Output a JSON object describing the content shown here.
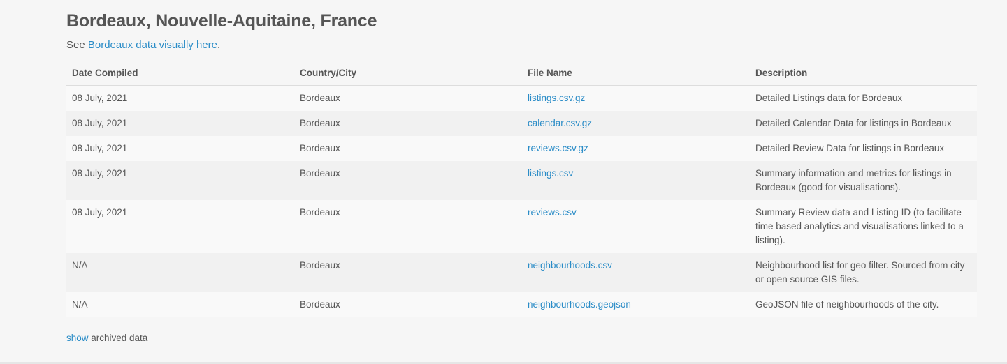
{
  "city": {
    "title": "Bordeaux, Nouvelle-Aquitaine, France",
    "see_prefix": "See ",
    "see_link": "Bordeaux data visually here",
    "see_suffix": "."
  },
  "table": {
    "headers": {
      "date": "Date Compiled",
      "city": "Country/City",
      "file": "File Name",
      "description": "Description"
    },
    "rows": [
      {
        "date": "08 July, 2021",
        "city": "Bordeaux",
        "file": "listings.csv.gz",
        "description": "Detailed Listings data for Bordeaux"
      },
      {
        "date": "08 July, 2021",
        "city": "Bordeaux",
        "file": "calendar.csv.gz",
        "description": "Detailed Calendar Data for listings in Bordeaux"
      },
      {
        "date": "08 July, 2021",
        "city": "Bordeaux",
        "file": "reviews.csv.gz",
        "description": "Detailed Review Data for listings in Bordeaux"
      },
      {
        "date": "08 July, 2021",
        "city": "Bordeaux",
        "file": "listings.csv",
        "description": "Summary information and metrics for listings in Bordeaux (good for visualisations)."
      },
      {
        "date": "08 July, 2021",
        "city": "Bordeaux",
        "file": "reviews.csv",
        "description": "Summary Review data and Listing ID (to facilitate time based analytics and visualisations linked to a listing)."
      },
      {
        "date": "N/A",
        "city": "Bordeaux",
        "file": "neighbourhoods.csv",
        "description": "Neighbourhood list for geo filter. Sourced from city or open source GIS files."
      },
      {
        "date": "N/A",
        "city": "Bordeaux",
        "file": "neighbourhoods.geojson",
        "description": "GeoJSON file of neighbourhoods of the city."
      }
    ]
  },
  "archived": {
    "link": "show",
    "text": " archived data"
  },
  "colors": {
    "link": "#2a8cc7",
    "text": "#555555",
    "background": "#f6f6f6"
  }
}
